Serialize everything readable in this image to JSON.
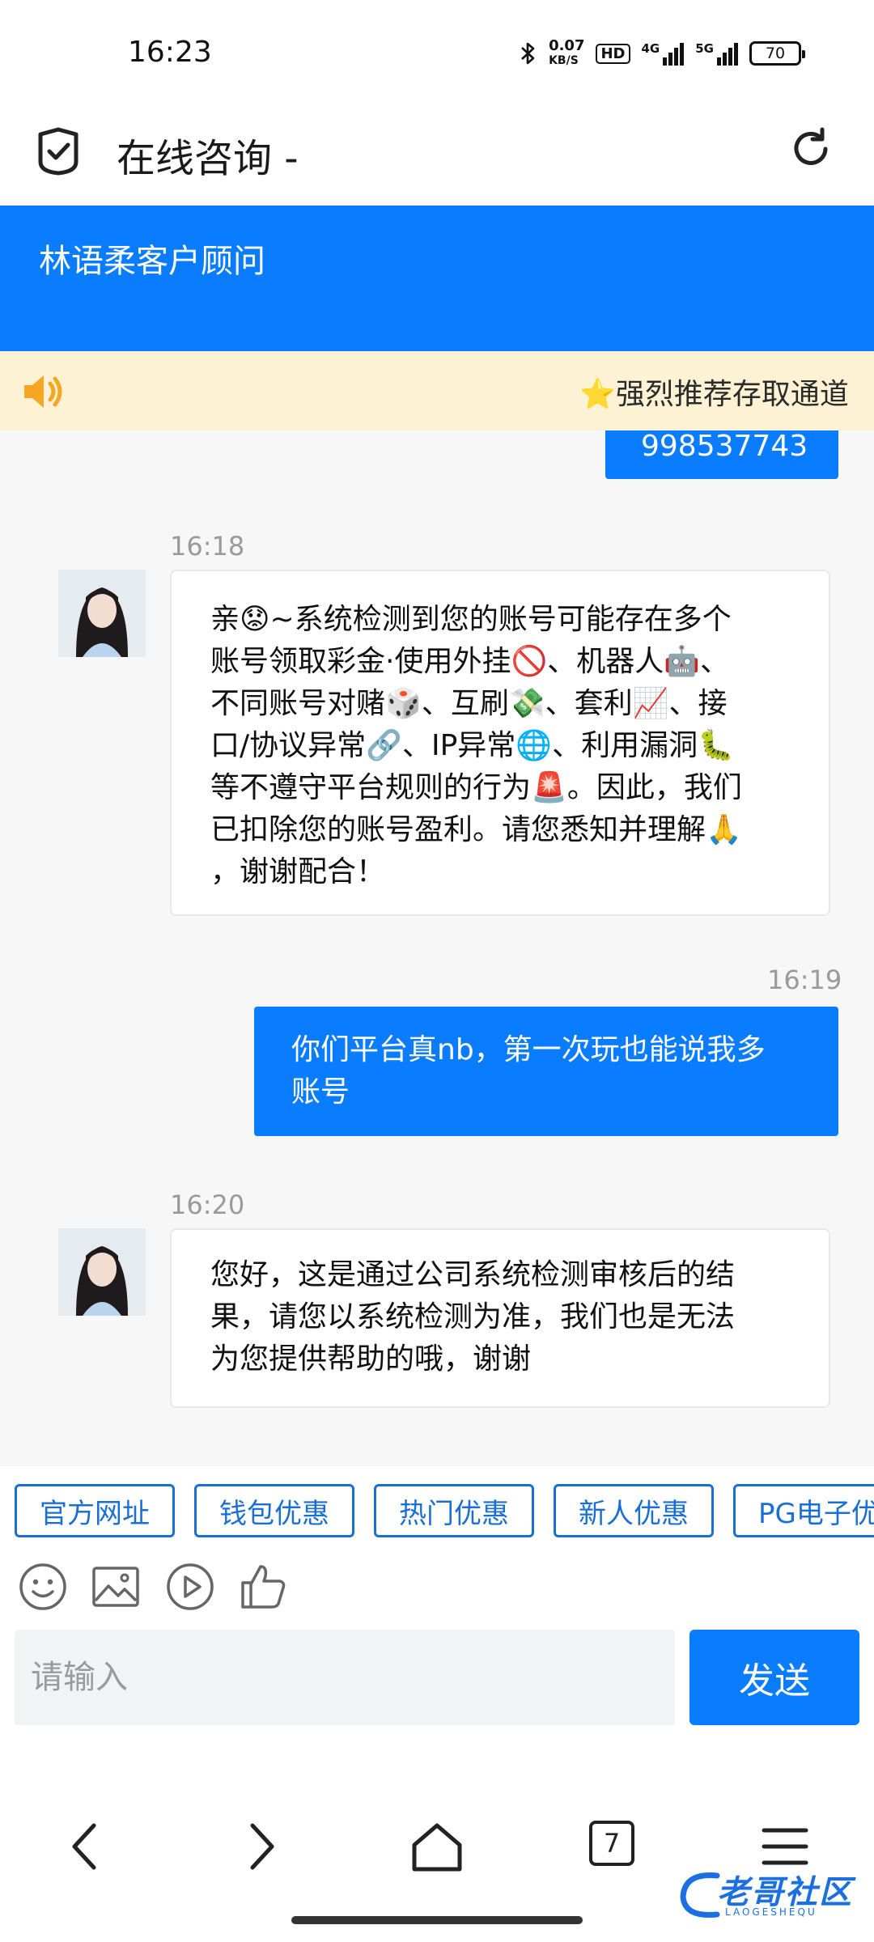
{
  "status_bar": {
    "time": "16:23",
    "speed_value": "0.07",
    "speed_unit": "KB/S",
    "hd": "HD",
    "net1": "4G",
    "net2": "5G",
    "battery": "70"
  },
  "browser": {
    "title": "在线咨询 -"
  },
  "chat_header": {
    "agent_name": "林语柔客户顾问"
  },
  "notice": {
    "text": "⭐强烈推荐存取通道"
  },
  "messages": {
    "top_partial": "998537743",
    "m1_time": "16:18",
    "m1_lines": [
      "亲😟~系统检测到您的账号可能存在多个",
      "账号领取彩金·使用外挂🚫、机器人🤖、",
      "不同账号对赌🎲、互刷💸、套利📈、接",
      "口/协议异常🔗、IP异常🌐、利用漏洞🐛",
      "等不遵守平台规则的行为🚨。因此，我们",
      "已扣除您的账号盈利。请您悉知并理解🙏",
      "，谢谢配合！"
    ],
    "m2_time": "16:19",
    "m2_lines": [
      "你们平台真nb，第一次玩也能说我多",
      "账号"
    ],
    "m3_time": "16:20",
    "m3_lines": [
      "您好，这是通过公司系统检测审核后的结",
      "果，请您以系统检测为准，我们也是无法",
      "为您提供帮助的哦，谢谢"
    ]
  },
  "quick_buttons": [
    "官方网址",
    "钱包优惠",
    "热门优惠",
    "新人优惠",
    "PG电子优惠"
  ],
  "input": {
    "placeholder": "请输入",
    "send_label": "发送"
  },
  "bottom_nav": {
    "tab_count": "7"
  },
  "watermark": {
    "text": "老哥社区",
    "sub": "LAOGESHEQU"
  }
}
